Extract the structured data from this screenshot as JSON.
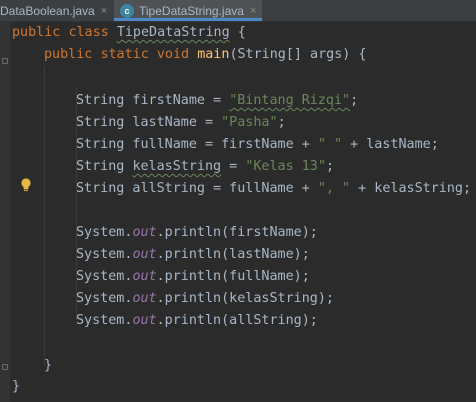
{
  "tabs": [
    {
      "label": "DataBoolean.java",
      "close": "×"
    },
    {
      "label": "TipeDataString.java",
      "icon": "java-class-icon",
      "icon_glyph": "c",
      "close": "×"
    }
  ],
  "code": {
    "l1": {
      "kw1": "public",
      "kw2": "class",
      "name": "TipeDataString",
      "brace": " {"
    },
    "l2": {
      "kw1": "public",
      "kw2": "static",
      "kw3": "void",
      "method": "main",
      "params": "(String[] args) {"
    },
    "l4": {
      "pre": "String firstName = ",
      "str": "\"Bintang Rizqi\"",
      "post": ";"
    },
    "l5": {
      "pre": "String lastName = ",
      "str": "\"Pasha\"",
      "post": ";"
    },
    "l6": {
      "pre": "String fullName = firstName + ",
      "str": "\" \"",
      "post": " + lastName;"
    },
    "l7": {
      "pre1": "String ",
      "var": "kelasString",
      "pre2": " = ",
      "str": "\"Kelas 13\"",
      "post": ";"
    },
    "l8": {
      "pre": "String allString = fullName + ",
      "str": "\", \"",
      "post": " + kelasString;"
    },
    "prints": [
      {
        "sys": "System.",
        "out": "out",
        "call": ".println(firstName);"
      },
      {
        "sys": "System.",
        "out": "out",
        "call": ".println(lastName);"
      },
      {
        "sys": "System.",
        "out": "out",
        "call": ".println(fullName);"
      },
      {
        "sys": "System.",
        "out": "out",
        "call": ".println(kelasString);"
      },
      {
        "sys": "System.",
        "out": "out",
        "call": ".println(allString);"
      }
    ],
    "close_inner": "}",
    "close_outer": "}"
  },
  "colors": {
    "background": "#2b2b2b",
    "keyword": "#cc7832",
    "string": "#6a8759",
    "method": "#ffc66d",
    "static_field": "#9876aa",
    "text": "#a9b7c6"
  }
}
